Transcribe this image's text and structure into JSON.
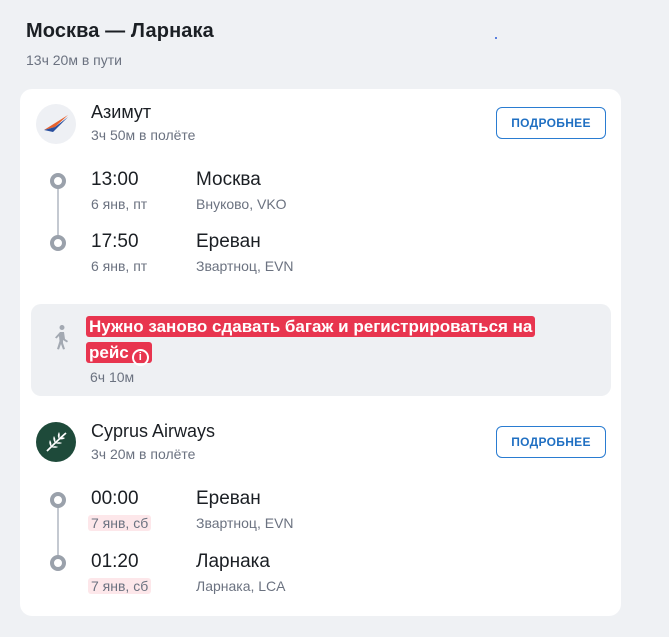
{
  "header": {
    "title": "Москва — Ларнака",
    "total_duration": "13ч 20м в пути"
  },
  "segments": [
    {
      "airline": "Азимут",
      "logo_icon": "azimuth-logo",
      "flight_duration": "3ч 50м в полёте",
      "details_label": "ПОДРОБНЕЕ",
      "departure": {
        "time": "13:00",
        "date": "6 янв, пт",
        "city": "Москва",
        "airport": "Внуково, VKO"
      },
      "arrival": {
        "time": "17:50",
        "date": "6 янв, пт",
        "city": "Ереван",
        "airport": "Звартноц, EVN"
      }
    },
    {
      "airline": "Cyprus Airways",
      "logo_icon": "cyprus-airways-logo",
      "flight_duration": "3ч 20м в полёте",
      "details_label": "ПОДРОБНЕЕ",
      "departure": {
        "time": "00:00",
        "date": "7 янв, сб",
        "city": "Ереван",
        "airport": "Звартноц, EVN"
      },
      "arrival": {
        "time": "01:20",
        "date": "7 янв, сб",
        "city": "Ларнака",
        "airport": "Ларнака, LCA"
      }
    }
  ],
  "transfer": {
    "warning": "Нужно заново сдавать багаж и регистрироваться на рейс",
    "duration": "6ч 10м",
    "icon": "walking-person-icon",
    "warning_color": "#e8354f"
  }
}
